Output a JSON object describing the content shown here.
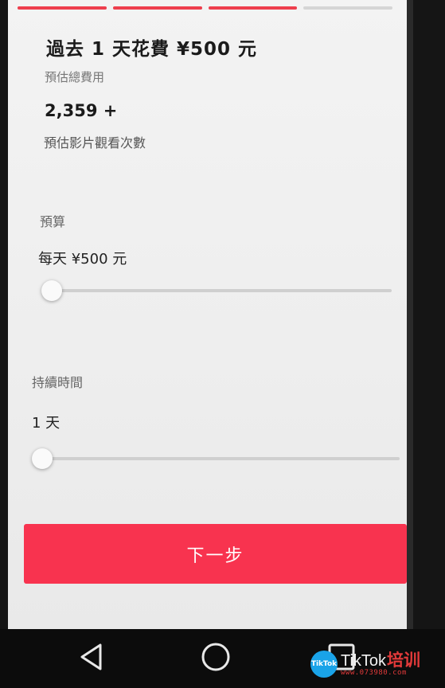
{
  "progress": {
    "steps": [
      {
        "fill": 1.0
      },
      {
        "fill": 1.0
      },
      {
        "fill": 1.0
      },
      {
        "fill": 0.0
      }
    ]
  },
  "summary": {
    "spend_title": "過去 1 天花費 ¥500 元",
    "spend_subtitle": "預估總費用",
    "views_value": "2,359 +",
    "views_label": "預估影片觀看次數"
  },
  "budget": {
    "label": "預算",
    "value": "每天 ¥500 元",
    "slider_level": 0.0
  },
  "duration": {
    "label": "持續時間",
    "value": "1 天",
    "slider_level": 0.0
  },
  "next_button": {
    "label": "下一步"
  },
  "nav": {
    "back_icon": "back-triangle-icon",
    "home_icon": "home-circle-icon",
    "recents_icon": "recents-square-icon"
  },
  "watermark": {
    "logo_text": "TikTok",
    "brand_en": "TikTok",
    "brand_cn": "培训",
    "url": "www.073980.com"
  },
  "colors": {
    "accent": "#ee3f4d",
    "button": "#f8334f"
  }
}
